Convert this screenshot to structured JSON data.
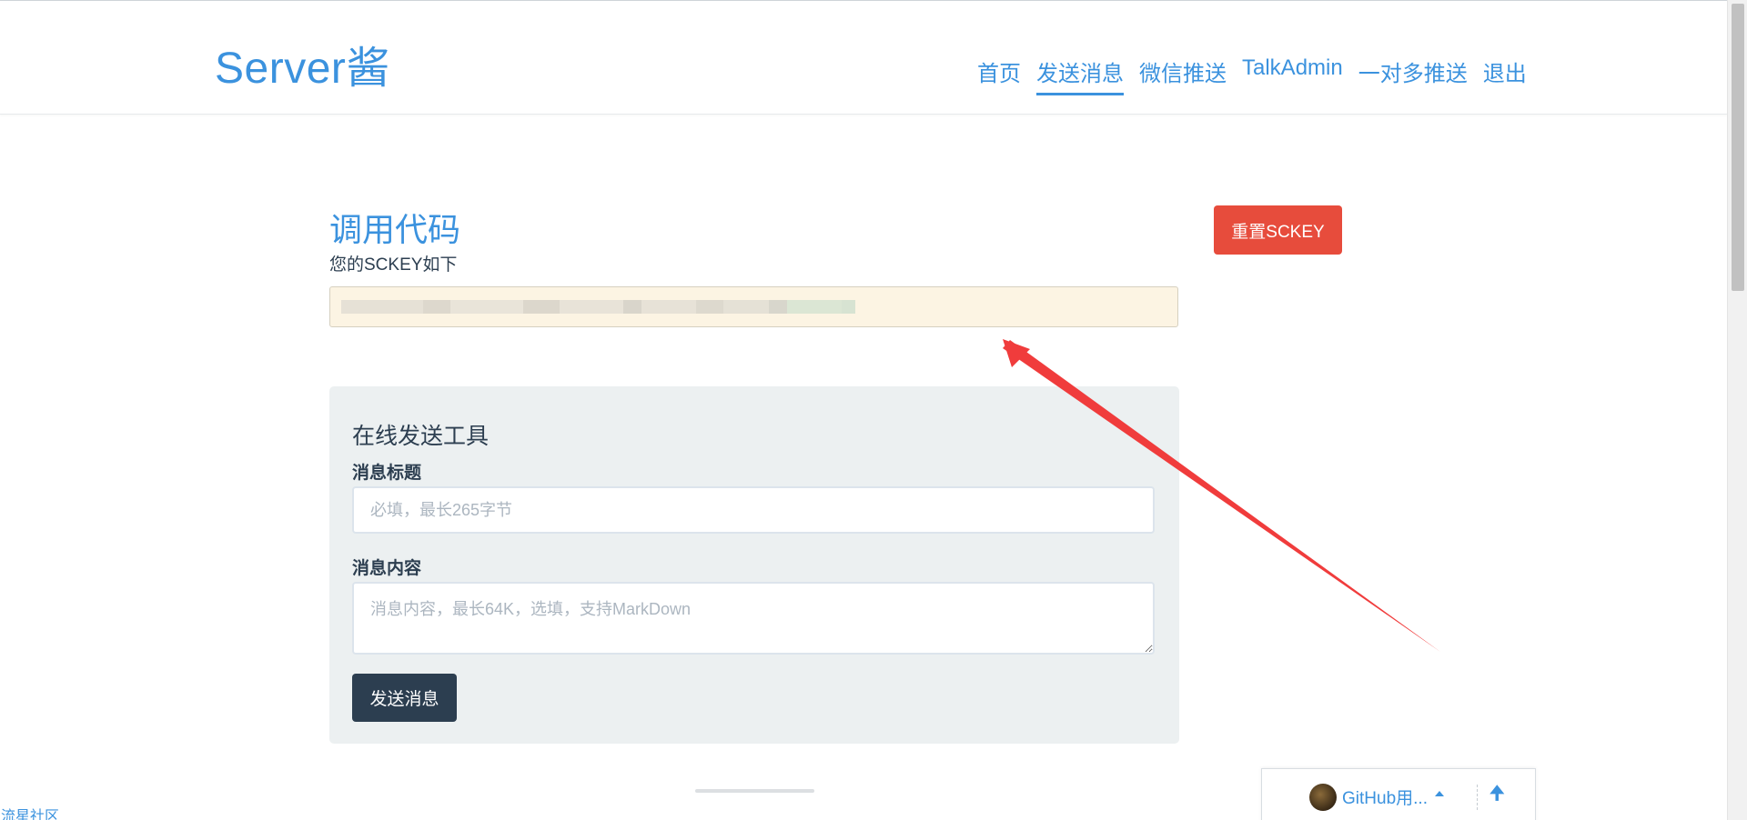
{
  "header": {
    "brand": "Server酱",
    "nav": [
      {
        "label": "首页",
        "active": false
      },
      {
        "label": "发送消息",
        "active": true
      },
      {
        "label": "微信推送",
        "active": false
      },
      {
        "label": "TalkAdmin",
        "active": false
      },
      {
        "label": "一对多推送",
        "active": false
      },
      {
        "label": "退出",
        "active": false
      }
    ]
  },
  "main": {
    "section_title": "调用代码",
    "sckey_label": "您的SCKEY如下",
    "sckey_value": "",
    "reset_button": "重置SCKEY"
  },
  "tool": {
    "title": "在线发送工具",
    "title_label": "消息标题",
    "title_placeholder": "必填，最长265字节",
    "content_label": "消息内容",
    "content_placeholder": "消息内容，最长64K，选填，支持MarkDown",
    "send_button": "发送消息"
  },
  "footer": {
    "community_link": "流星社区",
    "github_user": "GitHub用..."
  },
  "colors": {
    "accent": "#3b92de",
    "danger": "#e74c3c",
    "dark": "#2c3e50",
    "annotation_arrow": "#f03c3c"
  },
  "icons": {
    "caret": "caret-up-icon",
    "back_to_top": "arrow-up-icon"
  }
}
